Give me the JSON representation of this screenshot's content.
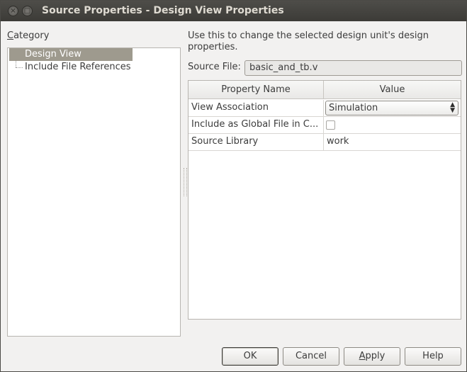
{
  "window": {
    "title": "Source Properties - Design View Properties",
    "close_glyph": "×",
    "max_glyph": "□"
  },
  "category": {
    "label_mnemonic": "C",
    "label_rest": "ategory",
    "items": [
      {
        "label": "Design View",
        "selected": true
      },
      {
        "label": "Include File References",
        "selected": false
      }
    ]
  },
  "main": {
    "description": "Use this to change the selected design unit's design properties.",
    "source_file_label": "Source File:",
    "source_file_value": "basic_and_tb.v",
    "table": {
      "headers": [
        "Property Name",
        "Value"
      ],
      "rows": [
        {
          "name": "View Association",
          "value": "Simulation",
          "kind": "combo"
        },
        {
          "name": "Include as Global File in C...",
          "value": "",
          "kind": "checkbox",
          "checked": false
        },
        {
          "name": "Source Library",
          "value": "work",
          "kind": "text"
        }
      ]
    }
  },
  "buttons": {
    "ok": "OK",
    "cancel": "Cancel",
    "apply_mnemonic": "A",
    "apply_rest": "pply",
    "help": "Help"
  },
  "colors": {
    "titlebar": "#3c3b37",
    "selection": "#9e9a8e",
    "window_bg": "#f2f1f0"
  },
  "icons": {
    "combo_arrow": "updown-arrow-icon"
  }
}
